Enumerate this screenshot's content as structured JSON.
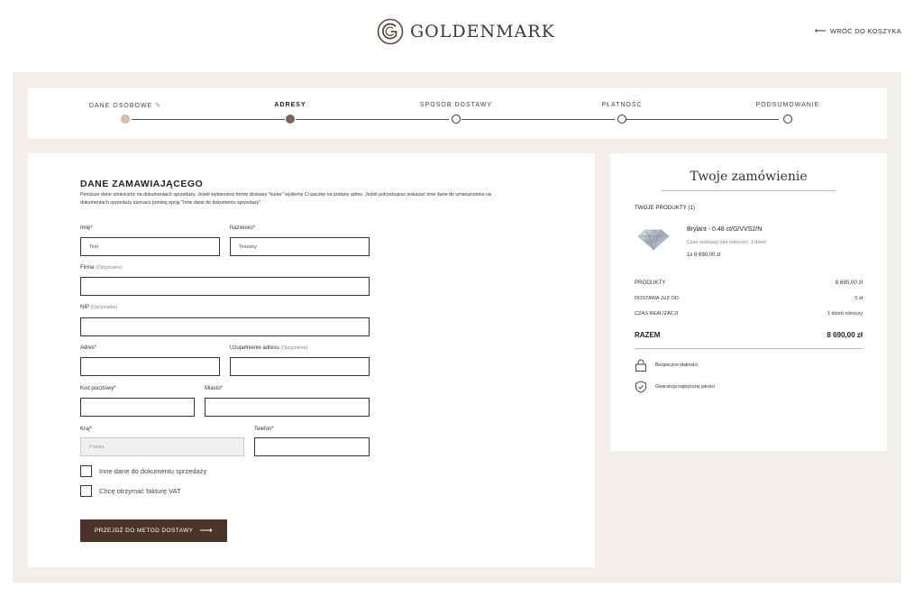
{
  "header": {
    "brand": "GOLDENMARK",
    "back_label": "WRÓĆ DO KOSZYKA",
    "back_arrow": "⟵"
  },
  "stepper": {
    "steps": [
      {
        "label": "DANE OSOBOWE",
        "state": "done"
      },
      {
        "label": "ADRESY",
        "state": "active"
      },
      {
        "label": "SPOSÓB DOSTAWY",
        "state": "pending"
      },
      {
        "label": "PŁATNOŚĆ",
        "state": "pending"
      },
      {
        "label": "PODSUMOWANIE",
        "state": "pending"
      }
    ],
    "edit_icon": "pencil-icon"
  },
  "form": {
    "title": "DANE ZAMAWIAJĄCEGO",
    "description": "Poniższe dane umieścimy na dokumentach sprzedaży. Jeżeli wybierzesz formę dostawy \"kurier\" wyślemy Ci paczkę na podany adres.  Jeżeli potrzebujesz wskazać inne dane do umieszczenia na dokumentach sprzedaży zaznacz poniżej opcję \"Inne dane do dokumentu sprzedaży\".",
    "first_name": {
      "label": "Imię*",
      "value": "Test"
    },
    "last_name": {
      "label": "Nazwisko*",
      "value": "Testowy"
    },
    "company": {
      "label": "Firma",
      "optional": "(Opcjonalne)",
      "value": ""
    },
    "nip": {
      "label": "NIP",
      "optional": "(Opcjonalne)",
      "value": ""
    },
    "address": {
      "label": "Adres*",
      "value": ""
    },
    "address2": {
      "label": "Uzupełnienie adresu",
      "optional": "(Opcjonalne)",
      "value": ""
    },
    "postal": {
      "label": "Kod pocztowy*",
      "value": ""
    },
    "city": {
      "label": "Miasto*",
      "value": ""
    },
    "country": {
      "label": "Kraj*",
      "value": "Polska"
    },
    "phone": {
      "label": "Telefon*",
      "value": ""
    },
    "checkbox_other": "Inne dane do dokumentu sprzedaży",
    "checkbox_vat": "Chcę otrzymać fakturę VAT",
    "submit_label": "PRZEJDŹ DO METOD DOSTAWY",
    "submit_arrow": "⟶"
  },
  "order": {
    "title": "Twoje zamówienie",
    "products_head": "TWOJE PRODUKTY (1)",
    "product": {
      "name": "Brylant - 0.48 ct/G/VVS2/N",
      "meta": "Czas realizacji (dni robocze): 1 dzień",
      "price": "1x 8 690,00 zł",
      "image_icon": "diamond-icon"
    },
    "rows": [
      {
        "label": "PRODUKTY",
        "value": "8 690,00 zł"
      },
      {
        "label": "DOSTAWA JUŻ OD",
        "value": "0 zł"
      },
      {
        "label": "CZAS REALIZACJI",
        "value": "1 dzień roboczy"
      }
    ],
    "total": {
      "label": "RAZEM",
      "value": "8 690,00 zł"
    },
    "perks": [
      {
        "icon": "lock-icon",
        "text": "Bezpieczne płatności"
      },
      {
        "icon": "shield-check-icon",
        "text": "Gwarancja najwyższej jakości"
      }
    ]
  },
  "colors": {
    "brand_brown": "#4b3527",
    "background_beige": "#f2eeea",
    "step_done": "#d5c1ad",
    "step_active": "#7a6457"
  }
}
